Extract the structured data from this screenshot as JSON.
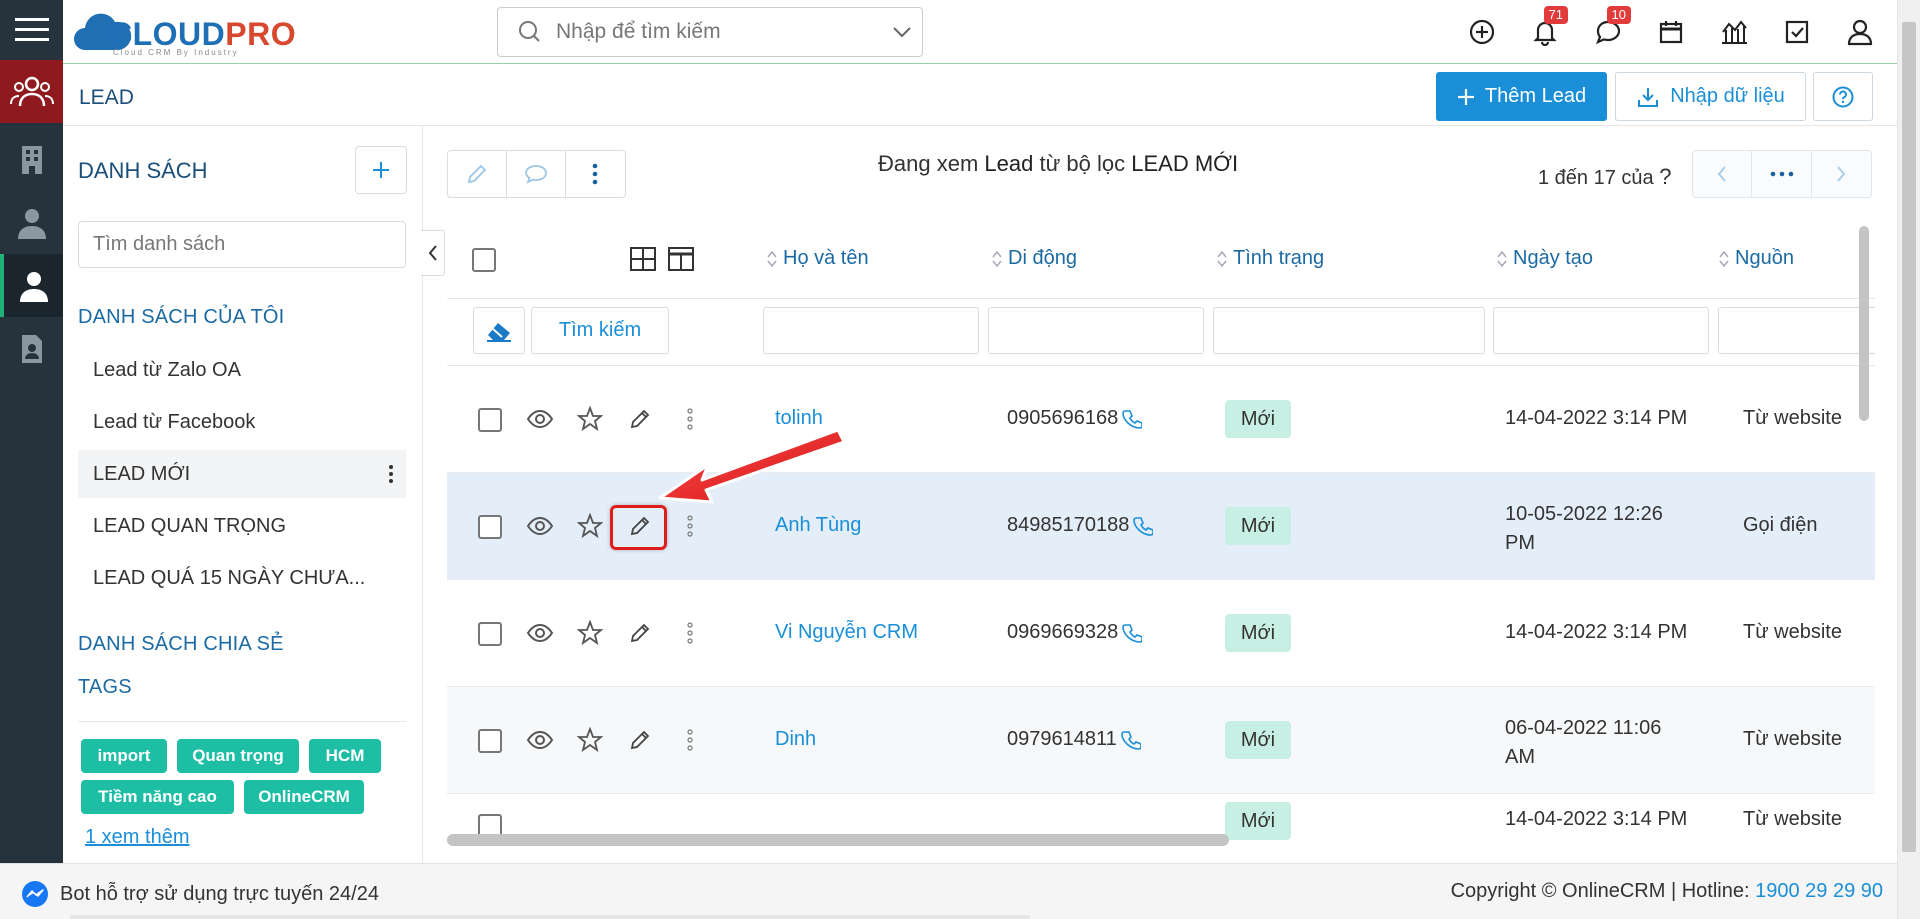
{
  "app": {
    "logo_text_a": "CLOUD",
    "logo_text_b": "PRO",
    "logo_tagline": "Cloud CRM By Industry",
    "search_placeholder": "Nhập để tìm kiếm",
    "notif_count": "71",
    "message_count": "10"
  },
  "header": {
    "title": "LEAD",
    "add_label": "Thêm Lead",
    "import_label": "Nhập dữ liệu"
  },
  "sidebar": {
    "title": "DANH SÁCH",
    "search_placeholder": "Tìm danh sách",
    "my_lists_title": "DANH SÁCH CỦA TÔI",
    "items": [
      {
        "label": "Lead từ Zalo OA"
      },
      {
        "label": "Lead từ Facebook"
      },
      {
        "label": "LEAD MỚI"
      },
      {
        "label": "LEAD QUAN TRỌNG"
      },
      {
        "label": "LEAD QUÁ 15 NGÀY CHƯA..."
      }
    ],
    "shared_title": "DANH SÁCH CHIA SẺ",
    "tags_title": "TAGS",
    "tags": [
      "import",
      "Quan trọng",
      "HCM",
      "Tiềm năng cao",
      "OnlineCRM"
    ],
    "see_more": "1  xem thêm"
  },
  "toolbar": {
    "viewing_pre": "Đang xem ",
    "viewing_module": "Lead",
    "viewing_mid": " từ bộ lọc ",
    "viewing_filter": "LEAD MỚI",
    "pager_text": "1 đến 17 của ",
    "pager_unknown": "?"
  },
  "table": {
    "columns": [
      "Họ và tên",
      "Di động",
      "Tình trạng",
      "Ngày tạo",
      "Nguồn"
    ],
    "search_button": "Tìm kiếm",
    "rows": [
      {
        "name": "tolinh",
        "phone": "0905696168",
        "status": "Mới",
        "created": "14-04-2022 3:14 PM",
        "created2": "",
        "source": "Từ website"
      },
      {
        "name": "Anh Tùng",
        "phone": "84985170188",
        "status": "Mới",
        "created": "10-05-2022 12:26",
        "created2": "PM",
        "source": "Gọi điện"
      },
      {
        "name": "Vi Nguyễn CRM",
        "phone": "0969669328",
        "status": "Mới",
        "created": "14-04-2022 3:14 PM",
        "created2": "",
        "source": "Từ website"
      },
      {
        "name": "Dinh",
        "phone": "0979614811",
        "status": "Mới",
        "created": "06-04-2022 11:06",
        "created2": "AM",
        "source": "Từ website"
      },
      {
        "name": "",
        "phone": "",
        "status": "Mới",
        "created": "14-04-2022 3:14 PM",
        "created2": "",
        "source": "Từ website"
      }
    ]
  },
  "footer": {
    "bot_text": "Bot hỗ trợ sử dụng trực tuyến 24/24",
    "copyright": "Copyright © OnlineCRM | Hotline: ",
    "hotline": "1900 29 29 90"
  },
  "colors": {
    "primary": "#1a8fd8",
    "rail": "#26323c",
    "status_bg": "#c8efe4",
    "highlight": "#e01b1b"
  }
}
